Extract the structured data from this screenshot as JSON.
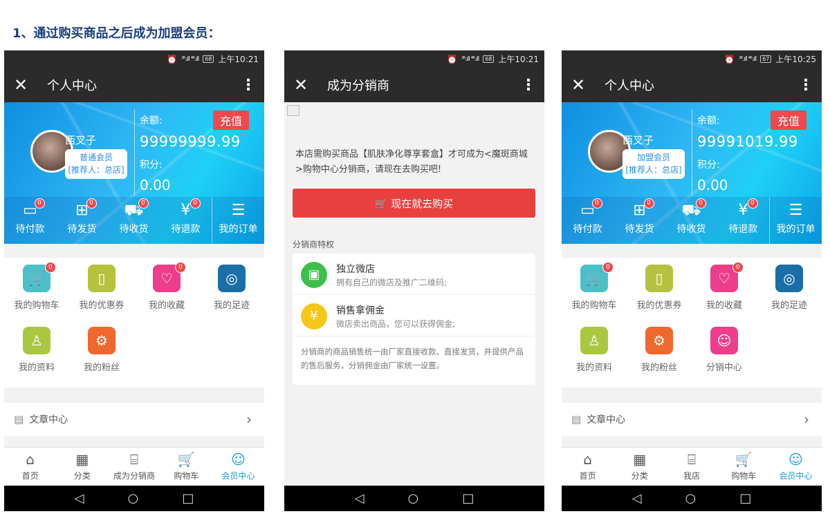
{
  "heading": "1、通过购买商品之后成为加盟会员：",
  "screens": [
    {
      "status": {
        "signal": "²⁶.ıll ⁴⁶.ıll",
        "battery": "68",
        "time": "上午10:21"
      },
      "title": "个人中心",
      "user": {
        "name": "西叉子",
        "level": "普通会员",
        "referrer": "[推荐人：总店]"
      },
      "balance": {
        "label": "余额:",
        "value": "99999999.99"
      },
      "points": {
        "label": "积分:",
        "value": "0.00"
      },
      "recharge_label": "充值",
      "orders": [
        {
          "label": "待付款",
          "count": "0"
        },
        {
          "label": "待发货",
          "count": "0"
        },
        {
          "label": "待收货",
          "count": "0"
        },
        {
          "label": "待退款",
          "count": "0"
        },
        {
          "label": "我的订单"
        }
      ],
      "menu": [
        {
          "label": "我的购物车",
          "count": "0",
          "icon": "cart-icon",
          "color": "#4cc0c8"
        },
        {
          "label": "我的优惠券",
          "icon": "phone-icon",
          "color": "#b5c23e"
        },
        {
          "label": "我的收藏",
          "count": "0",
          "icon": "heart-icon",
          "color": "#ec3e8a"
        },
        {
          "label": "我的足迹",
          "icon": "footprint-icon",
          "color": "#1a6fa6"
        },
        {
          "label": "我的资料",
          "icon": "profile-icon",
          "color": "#a9c83f"
        },
        {
          "label": "我的粉丝",
          "icon": "fans-icon",
          "color": "#f0682d"
        }
      ],
      "article": "文章中心",
      "tabs": [
        "首页",
        "分类",
        "成为分销商",
        "购物车",
        "会员中心"
      ]
    },
    {
      "status": {
        "signal": "²⁶.ıll ⁴⁶.ıll",
        "battery": "68",
        "time": "上午10:21"
      },
      "title": "成为分销商",
      "notice": "本店需购买商品【肌肤净化尊享套盒】才可成为<魔斑商城>购物中心分销商，请现在去购买吧!",
      "buy_label": "现在就去购买",
      "priv_title": "分销商特权",
      "privileges": [
        {
          "title": "独立微店",
          "desc": "拥有自己的微店及推广二维码;",
          "icon": "qrcode-icon",
          "color": "#3cc04a"
        },
        {
          "title": "销售拿佣金",
          "desc": "微店卖出商品，您可以获得佣金;",
          "icon": "yen-icon",
          "color": "#f5c718"
        }
      ],
      "priv_note": "分销商的商品销售统一由厂家直接收款、直接发货，并提供产品的售后服务，分销佣金由厂家统一设置。"
    },
    {
      "status": {
        "signal": "²⁶.ıll ⁴⁶.ıll",
        "battery": "67",
        "time": "上午10:25"
      },
      "title": "个人中心",
      "user": {
        "name": "西叉子",
        "level": "加盟会员",
        "referrer": "[推荐人：总店]"
      },
      "balance": {
        "label": "余额:",
        "value": "99991019.99"
      },
      "points": {
        "label": "积分:",
        "value": "0.00"
      },
      "recharge_label": "充值",
      "orders": [
        {
          "label": "待付款",
          "count": "0"
        },
        {
          "label": "待发货",
          "count": "0"
        },
        {
          "label": "待收货",
          "count": "0"
        },
        {
          "label": "待退款",
          "count": "0"
        },
        {
          "label": "我的订单"
        }
      ],
      "menu": [
        {
          "label": "我的购物车",
          "count": "0",
          "icon": "cart-icon",
          "color": "#4cc0c8"
        },
        {
          "label": "我的优惠券",
          "icon": "phone-icon",
          "color": "#b5c23e"
        },
        {
          "label": "我的收藏",
          "count": "0",
          "icon": "heart-icon",
          "color": "#ec3e8a"
        },
        {
          "label": "我的足迹",
          "icon": "footprint-icon",
          "color": "#1a6fa6"
        },
        {
          "label": "我的资料",
          "icon": "profile-icon",
          "color": "#a9c83f"
        },
        {
          "label": "我的粉丝",
          "icon": "fans-icon",
          "color": "#f0682d"
        },
        {
          "label": "分销中心",
          "icon": "group-icon",
          "color": "#ec3e8a"
        }
      ],
      "article": "文章中心",
      "tabs": [
        "首页",
        "分类",
        "我店",
        "购物车",
        "会员中心"
      ]
    }
  ]
}
